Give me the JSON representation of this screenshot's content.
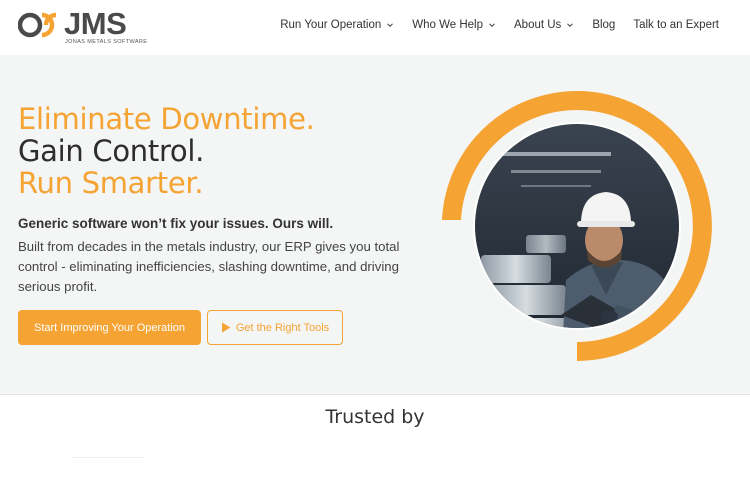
{
  "brand": {
    "name": "JMS",
    "tagline": "JONAS METALS SOFTWARE",
    "colors": {
      "accent": "#f5a333",
      "dark": "#4a4a4a",
      "hero_bg": "#f4f5f5"
    }
  },
  "nav": {
    "items": [
      {
        "label": "Run Your Operation",
        "has_dropdown": true
      },
      {
        "label": "Who We Help",
        "has_dropdown": true
      },
      {
        "label": "About Us",
        "has_dropdown": true
      },
      {
        "label": "Blog",
        "has_dropdown": false
      },
      {
        "label": "Talk to an Expert",
        "has_dropdown": false
      }
    ]
  },
  "hero": {
    "headline_1": "Eliminate Downtime.",
    "headline_2": "Gain Control.",
    "headline_3": "Run Smarter.",
    "subheading": "Generic software won’t fix your issues. Ours will.",
    "body": "Built from decades in the metals industry, our ERP gives you total control - eliminating inefficiencies, slashing downtime, and driving serious profit.",
    "primary_cta": "Start Improving Your Operation",
    "secondary_cta": "Get the Right Tools",
    "image_icon": "warehouse-worker-photo"
  },
  "trusted": {
    "title": "Trusted by"
  }
}
